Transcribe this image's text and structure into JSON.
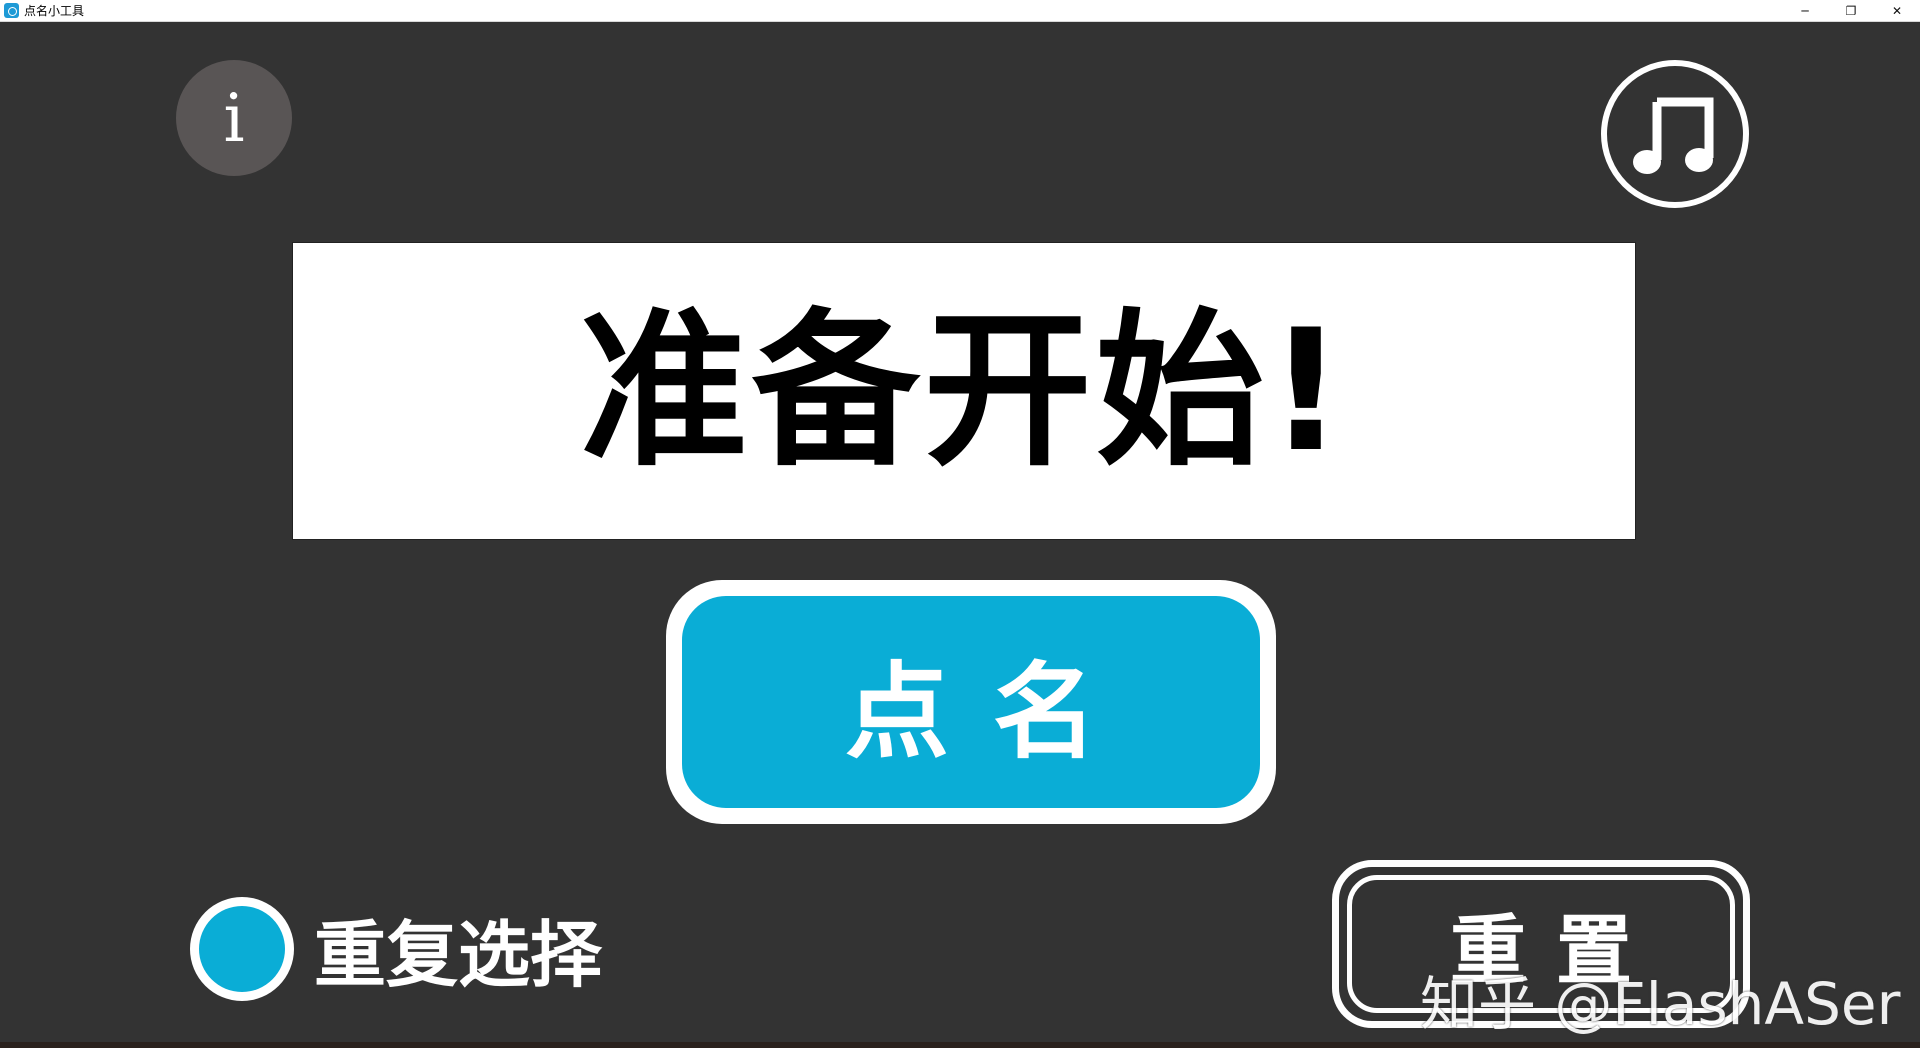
{
  "window": {
    "title": "点名小工具",
    "minimize_glyph": "─",
    "restore_glyph": "❐",
    "close_glyph": "✕"
  },
  "toolbar": {
    "info_glyph": "i",
    "info_icon": "info-icon",
    "music_icon": "music-note-icon"
  },
  "display": {
    "text": "准备开始!"
  },
  "actions": {
    "call_label": "点名",
    "reset_label": "重置"
  },
  "options": {
    "repeat_label": "重复选择",
    "repeat_selected": true
  },
  "watermark": {
    "text": "知乎 @FlashASer"
  },
  "colors": {
    "background": "#333333",
    "accent": "#0aadd6",
    "info_bg": "#595555"
  }
}
